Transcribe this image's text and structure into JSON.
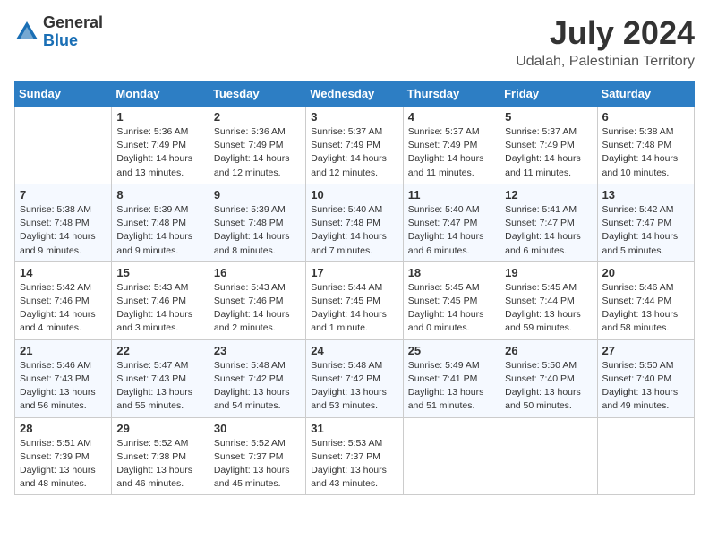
{
  "logo": {
    "general": "General",
    "blue": "Blue"
  },
  "title": "July 2024",
  "location": "Udalah, Palestinian Territory",
  "headers": [
    "Sunday",
    "Monday",
    "Tuesday",
    "Wednesday",
    "Thursday",
    "Friday",
    "Saturday"
  ],
  "weeks": [
    [
      {
        "day": "",
        "info": ""
      },
      {
        "day": "1",
        "info": "Sunrise: 5:36 AM\nSunset: 7:49 PM\nDaylight: 14 hours\nand 13 minutes."
      },
      {
        "day": "2",
        "info": "Sunrise: 5:36 AM\nSunset: 7:49 PM\nDaylight: 14 hours\nand 12 minutes."
      },
      {
        "day": "3",
        "info": "Sunrise: 5:37 AM\nSunset: 7:49 PM\nDaylight: 14 hours\nand 12 minutes."
      },
      {
        "day": "4",
        "info": "Sunrise: 5:37 AM\nSunset: 7:49 PM\nDaylight: 14 hours\nand 11 minutes."
      },
      {
        "day": "5",
        "info": "Sunrise: 5:37 AM\nSunset: 7:49 PM\nDaylight: 14 hours\nand 11 minutes."
      },
      {
        "day": "6",
        "info": "Sunrise: 5:38 AM\nSunset: 7:48 PM\nDaylight: 14 hours\nand 10 minutes."
      }
    ],
    [
      {
        "day": "7",
        "info": "Sunrise: 5:38 AM\nSunset: 7:48 PM\nDaylight: 14 hours\nand 9 minutes."
      },
      {
        "day": "8",
        "info": "Sunrise: 5:39 AM\nSunset: 7:48 PM\nDaylight: 14 hours\nand 9 minutes."
      },
      {
        "day": "9",
        "info": "Sunrise: 5:39 AM\nSunset: 7:48 PM\nDaylight: 14 hours\nand 8 minutes."
      },
      {
        "day": "10",
        "info": "Sunrise: 5:40 AM\nSunset: 7:48 PM\nDaylight: 14 hours\nand 7 minutes."
      },
      {
        "day": "11",
        "info": "Sunrise: 5:40 AM\nSunset: 7:47 PM\nDaylight: 14 hours\nand 6 minutes."
      },
      {
        "day": "12",
        "info": "Sunrise: 5:41 AM\nSunset: 7:47 PM\nDaylight: 14 hours\nand 6 minutes."
      },
      {
        "day": "13",
        "info": "Sunrise: 5:42 AM\nSunset: 7:47 PM\nDaylight: 14 hours\nand 5 minutes."
      }
    ],
    [
      {
        "day": "14",
        "info": "Sunrise: 5:42 AM\nSunset: 7:46 PM\nDaylight: 14 hours\nand 4 minutes."
      },
      {
        "day": "15",
        "info": "Sunrise: 5:43 AM\nSunset: 7:46 PM\nDaylight: 14 hours\nand 3 minutes."
      },
      {
        "day": "16",
        "info": "Sunrise: 5:43 AM\nSunset: 7:46 PM\nDaylight: 14 hours\nand 2 minutes."
      },
      {
        "day": "17",
        "info": "Sunrise: 5:44 AM\nSunset: 7:45 PM\nDaylight: 14 hours\nand 1 minute."
      },
      {
        "day": "18",
        "info": "Sunrise: 5:45 AM\nSunset: 7:45 PM\nDaylight: 14 hours\nand 0 minutes."
      },
      {
        "day": "19",
        "info": "Sunrise: 5:45 AM\nSunset: 7:44 PM\nDaylight: 13 hours\nand 59 minutes."
      },
      {
        "day": "20",
        "info": "Sunrise: 5:46 AM\nSunset: 7:44 PM\nDaylight: 13 hours\nand 58 minutes."
      }
    ],
    [
      {
        "day": "21",
        "info": "Sunrise: 5:46 AM\nSunset: 7:43 PM\nDaylight: 13 hours\nand 56 minutes."
      },
      {
        "day": "22",
        "info": "Sunrise: 5:47 AM\nSunset: 7:43 PM\nDaylight: 13 hours\nand 55 minutes."
      },
      {
        "day": "23",
        "info": "Sunrise: 5:48 AM\nSunset: 7:42 PM\nDaylight: 13 hours\nand 54 minutes."
      },
      {
        "day": "24",
        "info": "Sunrise: 5:48 AM\nSunset: 7:42 PM\nDaylight: 13 hours\nand 53 minutes."
      },
      {
        "day": "25",
        "info": "Sunrise: 5:49 AM\nSunset: 7:41 PM\nDaylight: 13 hours\nand 51 minutes."
      },
      {
        "day": "26",
        "info": "Sunrise: 5:50 AM\nSunset: 7:40 PM\nDaylight: 13 hours\nand 50 minutes."
      },
      {
        "day": "27",
        "info": "Sunrise: 5:50 AM\nSunset: 7:40 PM\nDaylight: 13 hours\nand 49 minutes."
      }
    ],
    [
      {
        "day": "28",
        "info": "Sunrise: 5:51 AM\nSunset: 7:39 PM\nDaylight: 13 hours\nand 48 minutes."
      },
      {
        "day": "29",
        "info": "Sunrise: 5:52 AM\nSunset: 7:38 PM\nDaylight: 13 hours\nand 46 minutes."
      },
      {
        "day": "30",
        "info": "Sunrise: 5:52 AM\nSunset: 7:37 PM\nDaylight: 13 hours\nand 45 minutes."
      },
      {
        "day": "31",
        "info": "Sunrise: 5:53 AM\nSunset: 7:37 PM\nDaylight: 13 hours\nand 43 minutes."
      },
      {
        "day": "",
        "info": ""
      },
      {
        "day": "",
        "info": ""
      },
      {
        "day": "",
        "info": ""
      }
    ]
  ]
}
